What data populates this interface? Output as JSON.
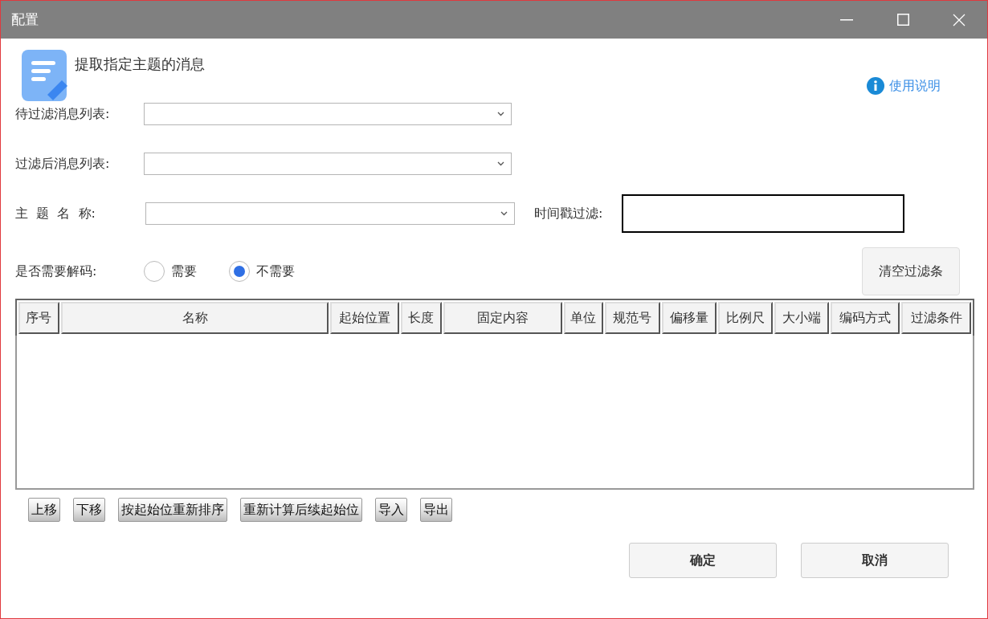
{
  "window": {
    "title": "配置"
  },
  "header": {
    "title": "提取指定主题的消息",
    "help_link": "使用说明"
  },
  "fields": [
    {
      "label": "待过滤消息列表:",
      "kind": "combo"
    },
    {
      "label": "过滤后消息列表:",
      "kind": "combo"
    }
  ],
  "topic": {
    "label": "主  题  名  称:",
    "timestamp_label": "时间戳过滤:"
  },
  "decode": {
    "label": "是否需要解码:",
    "options": [
      {
        "label": "需要",
        "selected": false
      },
      {
        "label": "不需要",
        "selected": true
      }
    ]
  },
  "clear_button": "清空过滤条",
  "table": {
    "columns": [
      "序号",
      "名称",
      "起始位置",
      "长度",
      "固定内容",
      "单位",
      "规范号",
      "偏移量",
      "比例尺",
      "大小端",
      "编码方式",
      "过滤条件"
    ]
  },
  "tool_buttons": [
    "上移",
    "下移",
    "按起始位重新排序",
    "重新计算后续起始位",
    "导入",
    "导出"
  ],
  "buttons": [
    "确定",
    "取消"
  ]
}
